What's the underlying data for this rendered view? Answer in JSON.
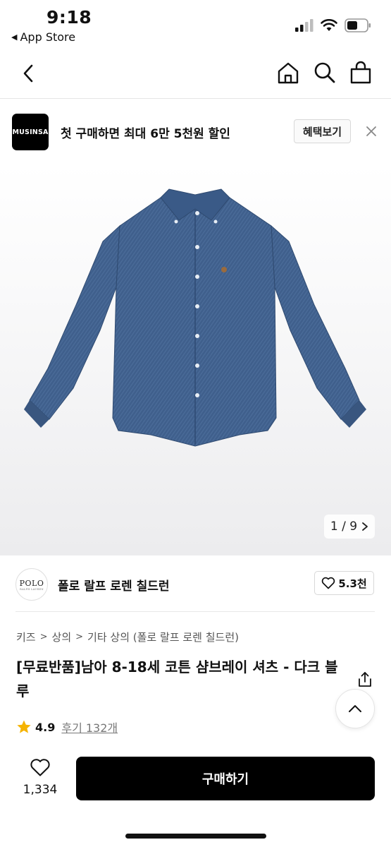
{
  "status_bar": {
    "time": "9:18",
    "back_app": "App Store",
    "icons": [
      "signal-icon",
      "wifi-icon",
      "battery-icon"
    ]
  },
  "nav": {
    "icons": [
      "back-icon",
      "home-icon",
      "search-icon",
      "shopping-bag-icon"
    ]
  },
  "promo": {
    "logo_text": "MUSINSA",
    "message": "첫 구매하면 최대 6만 5천원 할인",
    "button_label": "혜택보기",
    "close_icon": "close-icon"
  },
  "gallery": {
    "indicator": "1 / 9",
    "current": 1,
    "total": 9
  },
  "brand": {
    "logo_text": "POLO",
    "logo_subtext": "RALPH LAUREN",
    "name": "폴로 랄프 로렌 칠드런",
    "likes": "5.3천"
  },
  "breadcrumb": [
    "키즈",
    "상의",
    "기타 상의 (폴로 랄프 로렌 칠드런)"
  ],
  "product": {
    "title": "[무료반품]남아 8-18세 코튼 샴브레이 셔츠 - 다크 블루",
    "rating": "4.9",
    "reviews": "후기 132개"
  },
  "bottom_bar": {
    "wish_count": "1,334",
    "buy_label": "구매하기"
  },
  "colors": {
    "accent": "#000000",
    "star": "#f5b301",
    "denim": "#3f5f8c"
  }
}
